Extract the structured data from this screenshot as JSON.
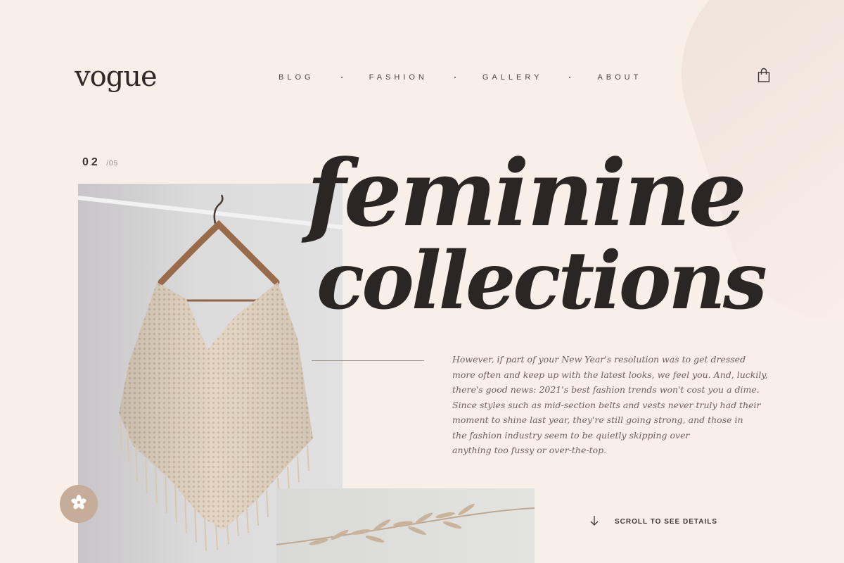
{
  "brand": {
    "logo": "vogue"
  },
  "nav": {
    "items": [
      "BLOG",
      "FASHION",
      "GALLERY",
      "ABOUT"
    ]
  },
  "icons": {
    "cart": "shopping-bag-icon",
    "scroll": "arrow-down-icon",
    "fab": "flower-icon"
  },
  "slide": {
    "current": "02",
    "total": "/05"
  },
  "hero": {
    "line1": "feminine",
    "line2": "collections"
  },
  "body": {
    "lines": [
      "However, if part of your New Year's resolution was to get dressed",
      "more often and keep up with the latest looks, we feel you. And, luckily,",
      "there's good news: 2021's best fashion trends won't cost you a dime.",
      "Since styles such as mid-section belts and vests never truly had their",
      "moment to shine last year, they're still going strong, and those in",
      "the fashion industry seem to be quietly skipping over",
      "anything too fussy or over-the-top."
    ]
  },
  "scroll": {
    "label": "SCROLL TO SEE DETAILS"
  },
  "colors": {
    "background": "#f9efe9",
    "text": "#2b2623",
    "accent": "#c5ad99"
  }
}
